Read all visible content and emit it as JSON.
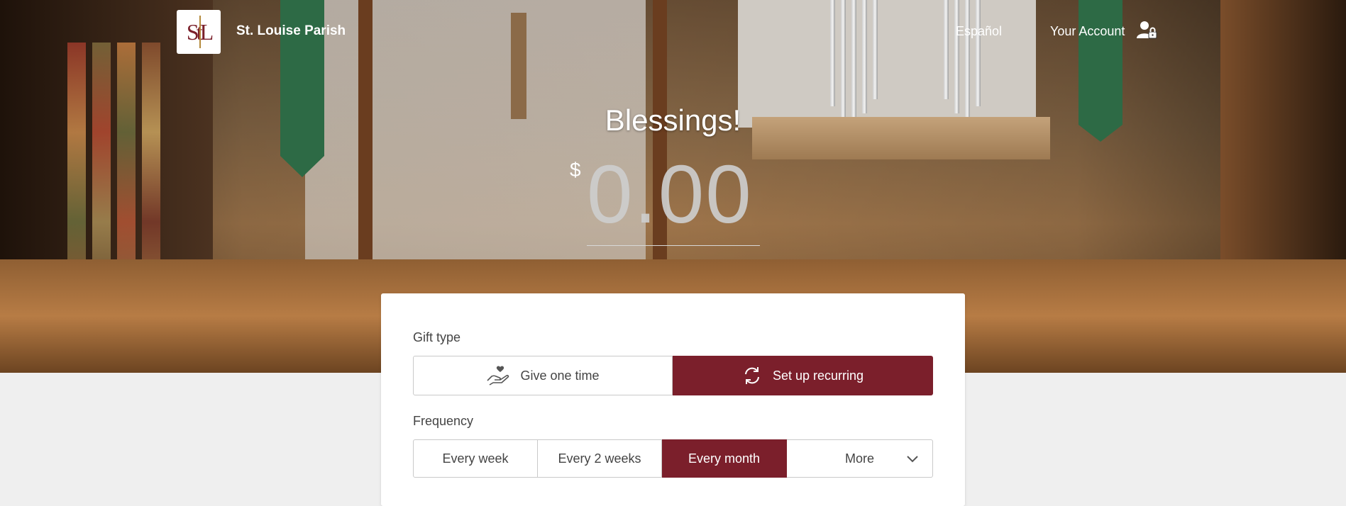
{
  "header": {
    "parish_name": "St. Louise Parish",
    "logo_text": "StL",
    "language_link": "Español",
    "account_link": "Your Account"
  },
  "hero": {
    "headline": "Blessings!",
    "currency_symbol": "$",
    "amount_placeholder": "0.00"
  },
  "gift_form": {
    "gift_type_label": "Gift type",
    "gift_types": [
      {
        "label": "Give one time",
        "icon": "hand-heart-icon",
        "selected": false
      },
      {
        "label": "Set up recurring",
        "icon": "recurring-arrows-icon",
        "selected": true
      }
    ],
    "frequency_label": "Frequency",
    "frequencies": [
      {
        "label": "Every week",
        "selected": false
      },
      {
        "label": "Every 2 weeks",
        "selected": false
      },
      {
        "label": "Every month",
        "selected": true
      },
      {
        "label": "More",
        "selected": false
      }
    ]
  },
  "colors": {
    "accent": "#7b1f2b",
    "page_background": "#efefef"
  }
}
